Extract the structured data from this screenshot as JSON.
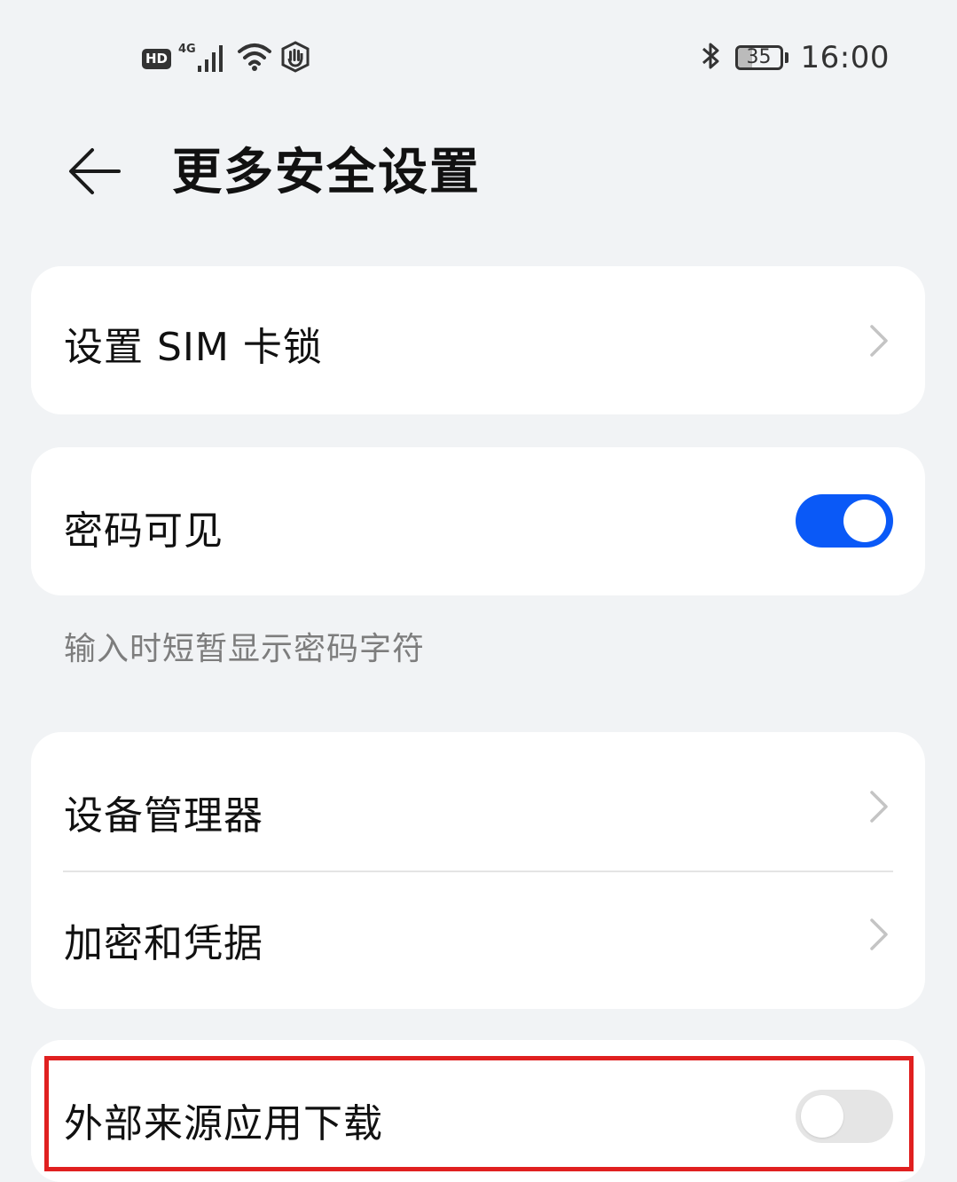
{
  "status_bar": {
    "hd_label": "HD",
    "network_type": "4G",
    "battery_level": "35",
    "battery_fraction": 0.35,
    "time": "16:00",
    "icons": [
      "hd-icon",
      "signal-icon",
      "wifi-icon",
      "shield-hand-icon",
      "bluetooth-icon",
      "battery-icon"
    ]
  },
  "header": {
    "back_icon": "arrow-left-icon",
    "title": "更多安全设置"
  },
  "sim_card": {
    "label": "设置 SIM 卡锁"
  },
  "password_visible": {
    "label": "密码可见",
    "enabled": true,
    "description": "输入时短暂显示密码字符"
  },
  "device_group": {
    "device_manager_label": "设备管理器",
    "encryption_label": "加密和凭据"
  },
  "external_sources": {
    "label": "外部来源应用下载",
    "enabled": false
  },
  "colors": {
    "accent": "#0a59f7",
    "highlight": "#e02020",
    "background": "#f1f3f5"
  }
}
